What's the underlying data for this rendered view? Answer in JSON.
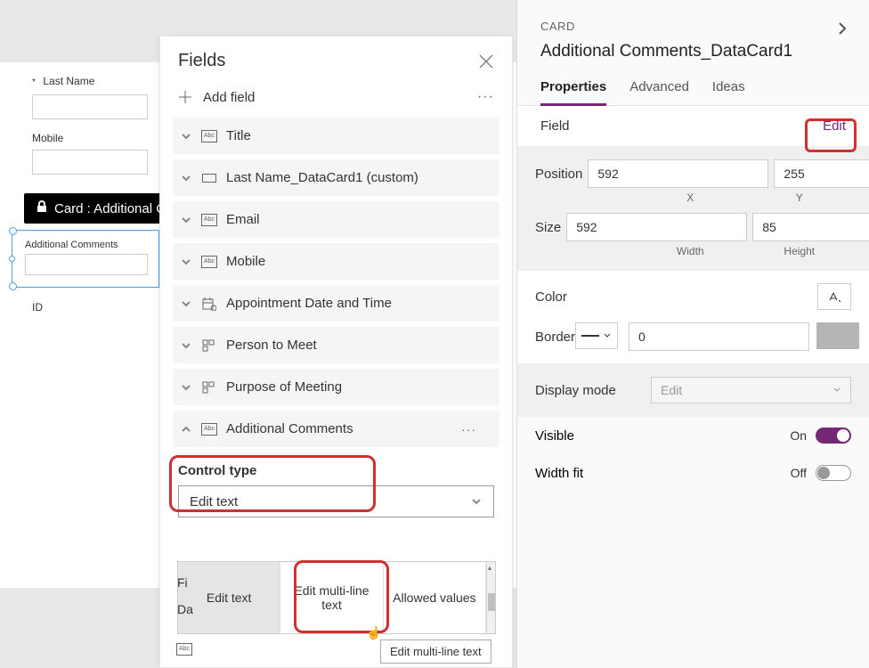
{
  "canvas": {
    "last_name_label": "Last Name",
    "mobile_label": "Mobile",
    "id_label": "ID",
    "additional_comments_label": "Additional Comments",
    "lock_text": "Card : Additional Co"
  },
  "fields_panel": {
    "title": "Fields",
    "add_label": "Add field",
    "items": [
      {
        "label": "Title",
        "icon": "abc",
        "expanded": false
      },
      {
        "label": "Last Name_DataCard1 (custom)",
        "icon": "rect",
        "expanded": false
      },
      {
        "label": "Email",
        "icon": "abc",
        "expanded": false
      },
      {
        "label": "Mobile",
        "icon": "abc",
        "expanded": false
      },
      {
        "label": "Appointment Date and Time",
        "icon": "cal",
        "expanded": false
      },
      {
        "label": "Person to Meet",
        "icon": "grid",
        "expanded": false
      },
      {
        "label": "Purpose of Meeting",
        "icon": "grid",
        "expanded": false
      },
      {
        "label": "Additional Comments",
        "icon": "abc",
        "expanded": true
      }
    ],
    "control_type_label": "Control type",
    "control_type_value": "Edit text",
    "options": [
      "Edit text",
      "Edit multi-line text",
      "Allowed values"
    ],
    "tooltip": "Edit multi-line text",
    "bottom": {
      "fi": "Fi",
      "da": "Da"
    }
  },
  "props": {
    "card_label": "CARD",
    "name": "Additional Comments_DataCard1",
    "tabs": {
      "properties": "Properties",
      "advanced": "Advanced",
      "ideas": "Ideas"
    },
    "field_label": "Field",
    "edit_label": "Edit",
    "position_label": "Position",
    "x": "592",
    "y": "255",
    "x_lbl": "X",
    "y_lbl": "Y",
    "size_label": "Size",
    "width": "592",
    "height": "85",
    "w_lbl": "Width",
    "h_lbl": "Height",
    "color_label": "Color",
    "border_label": "Border",
    "border_value": "0",
    "display_mode_label": "Display mode",
    "display_mode_value": "Edit",
    "visible_label": "Visible",
    "visible_value": "On",
    "widthfit_label": "Width fit",
    "widthfit_value": "Off"
  }
}
